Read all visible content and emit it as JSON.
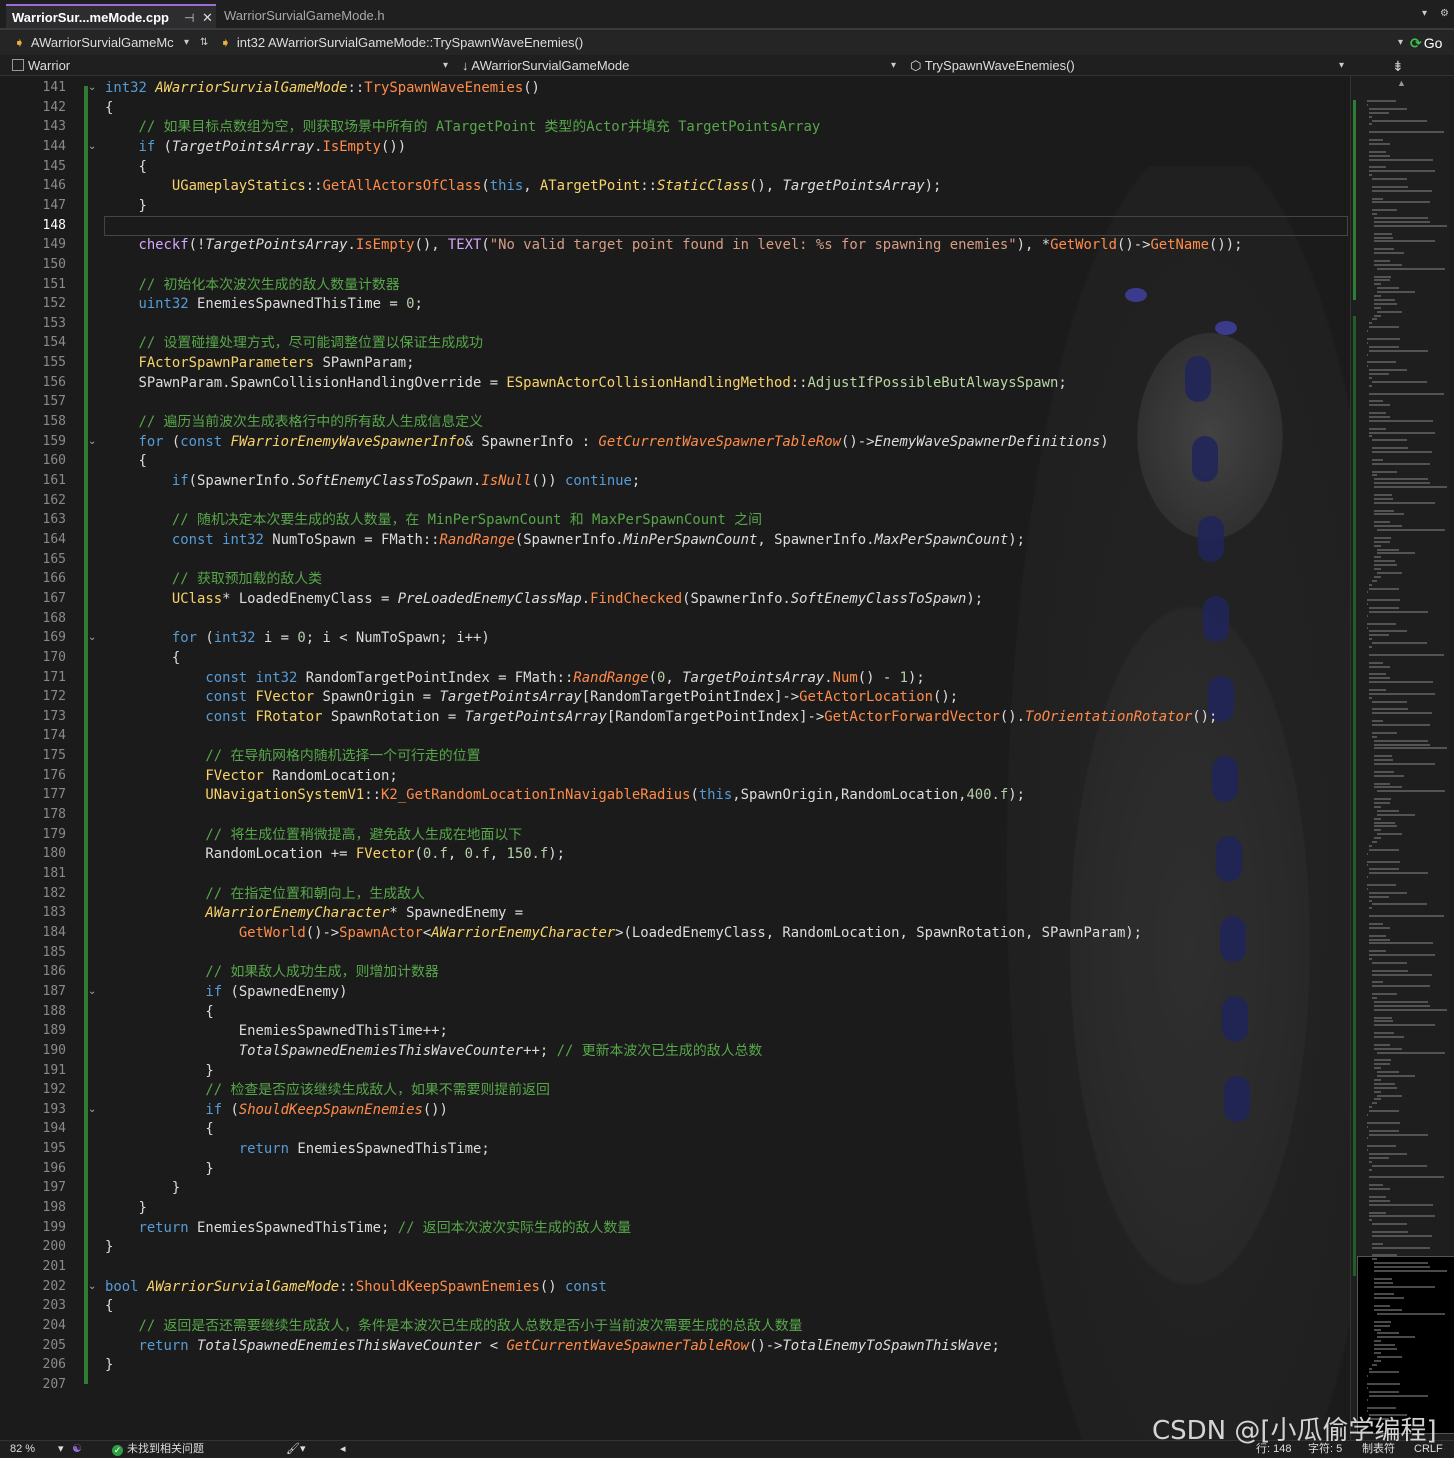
{
  "tabs": [
    {
      "label": "WarriorSur...meMode.cpp",
      "pin": "⊣",
      "close": "✕"
    },
    {
      "label": "WarriorSurvialGameMode.h"
    }
  ],
  "nav": {
    "class_combo": "AWarriorSurvialGameMc",
    "function_combo": "int32 AWarriorSurvialGameMode::TrySpawnWaveEnemies()",
    "go_label": "Go"
  },
  "scope": {
    "project": "Warrior",
    "class": "AWarriorSurvialGameMode",
    "member": "TrySpawnWaveEnemies()"
  },
  "editor": {
    "line_numbers": [
      "141",
      "142",
      "143",
      "144",
      "145",
      "146",
      "147",
      "148",
      "149",
      "150",
      "151",
      "152",
      "153",
      "154",
      "155",
      "156",
      "157",
      "158",
      "159",
      "160",
      "161",
      "162",
      "163",
      "164",
      "165",
      "166",
      "167",
      "168",
      "169",
      "170",
      "171",
      "172",
      "173",
      "174",
      "175",
      "176",
      "177",
      "178",
      "179",
      "180",
      "181",
      "182",
      "183",
      "184",
      "185",
      "186",
      "187",
      "188",
      "189",
      "190",
      "191",
      "192",
      "193",
      "194",
      "195",
      "196",
      "197",
      "198",
      "199",
      "200",
      "201",
      "202",
      "203",
      "204",
      "205",
      "206",
      "207"
    ],
    "current_line_index": 7
  },
  "code_lines": [
    [
      [
        "int32 ",
        "kw"
      ],
      [
        "AWarriorSurvialGameMode",
        "ut it"
      ],
      [
        "::",
        ""
      ],
      [
        "TrySpawnWaveEnemies",
        "fn"
      ],
      [
        "()",
        ""
      ]
    ],
    [
      [
        "{",
        ""
      ]
    ],
    [
      [
        "    ",
        ""
      ],
      [
        "// 如果目标点数组为空，则获取场景中所有的 ATargetPoint 类型的Actor并填充 TargetPointsArray",
        "cm"
      ]
    ],
    [
      [
        "    ",
        ""
      ],
      [
        "if ",
        "kw"
      ],
      [
        "(",
        ""
      ],
      [
        "TargetPointsArray",
        "it"
      ],
      [
        ".",
        ""
      ],
      [
        "IsEmpty",
        "fn"
      ],
      [
        "())",
        ""
      ]
    ],
    [
      [
        "    {",
        ""
      ]
    ],
    [
      [
        "        ",
        ""
      ],
      [
        "UGameplayStatics",
        "ut"
      ],
      [
        "::",
        ""
      ],
      [
        "GetAllActorsOfClass",
        "fn"
      ],
      [
        "(",
        ""
      ],
      [
        "this",
        "kw"
      ],
      [
        ", ",
        ""
      ],
      [
        "ATargetPoint",
        "ut"
      ],
      [
        "::",
        ""
      ],
      [
        "StaticClass",
        "ut it"
      ],
      [
        "(), ",
        ""
      ],
      [
        "TargetPointsArray",
        "it"
      ],
      [
        ");",
        ""
      ]
    ],
    [
      [
        "    }",
        ""
      ]
    ],
    [
      [
        "",
        ""
      ]
    ],
    [
      [
        "    ",
        ""
      ],
      [
        "checkf",
        "mac"
      ],
      [
        "(!",
        ""
      ],
      [
        "TargetPointsArray",
        "it"
      ],
      [
        ".",
        ""
      ],
      [
        "IsEmpty",
        "fn"
      ],
      [
        "(), ",
        ""
      ],
      [
        "TEXT",
        "mac"
      ],
      [
        "(",
        ""
      ],
      [
        "\"No valid target point found in level: %s for spawning enemies\"",
        "st"
      ],
      [
        "), *",
        ""
      ],
      [
        "GetWorld",
        "fn"
      ],
      [
        "()->",
        ""
      ],
      [
        "GetName",
        "fn"
      ],
      [
        "());",
        ""
      ]
    ],
    [
      [
        "",
        ""
      ]
    ],
    [
      [
        "    ",
        ""
      ],
      [
        "// 初始化本次波次生成的敌人数量计数器",
        "cm"
      ]
    ],
    [
      [
        "    ",
        ""
      ],
      [
        "uint32 ",
        "kw"
      ],
      [
        "EnemiesSpawnedThisTime = ",
        ""
      ],
      [
        "0",
        "nm"
      ],
      [
        ";",
        ""
      ]
    ],
    [
      [
        "",
        ""
      ]
    ],
    [
      [
        "    ",
        ""
      ],
      [
        "// 设置碰撞处理方式，尽可能调整位置以保证生成成功",
        "cm"
      ]
    ],
    [
      [
        "    ",
        ""
      ],
      [
        "FActorSpawnParameters ",
        "ut"
      ],
      [
        "SPawnParam;",
        ""
      ]
    ],
    [
      [
        "    SPawnParam.SpawnCollisionHandlingOverride = ",
        ""
      ],
      [
        "ESpawnActorCollisionHandlingMethod",
        "ut"
      ],
      [
        "::",
        ""
      ],
      [
        "AdjustIfPossibleButAlwaysSpawn",
        "en"
      ],
      [
        ";",
        ""
      ]
    ],
    [
      [
        "",
        ""
      ]
    ],
    [
      [
        "    ",
        ""
      ],
      [
        "// 遍历当前波次生成表格行中的所有敌人生成信息定义",
        "cm"
      ]
    ],
    [
      [
        "    ",
        ""
      ],
      [
        "for ",
        "kw"
      ],
      [
        "(",
        ""
      ],
      [
        "const ",
        "kw"
      ],
      [
        "FWarriorEnemyWaveSpawnerInfo",
        "ut it"
      ],
      [
        "& SpawnerInfo : ",
        ""
      ],
      [
        "GetCurrentWaveSpawnerTableRow",
        "fn it"
      ],
      [
        "()->",
        ""
      ],
      [
        "EnemyWaveSpawnerDefinitions",
        "it"
      ],
      [
        ")",
        ""
      ]
    ],
    [
      [
        "    {",
        ""
      ]
    ],
    [
      [
        "        ",
        ""
      ],
      [
        "if",
        "kw"
      ],
      [
        "(SpawnerInfo.",
        ""
      ],
      [
        "SoftEnemyClassToSpawn",
        "it"
      ],
      [
        ".",
        ""
      ],
      [
        "IsNull",
        "fn it"
      ],
      [
        "()) ",
        ""
      ],
      [
        "continue",
        "kw"
      ],
      [
        ";",
        ""
      ]
    ],
    [
      [
        "",
        ""
      ]
    ],
    [
      [
        "        ",
        ""
      ],
      [
        "// 随机决定本次要生成的敌人数量，在 MinPerSpawnCount 和 MaxPerSpawnCount 之间",
        "cm"
      ]
    ],
    [
      [
        "        ",
        ""
      ],
      [
        "const ",
        "kw"
      ],
      [
        "int32 ",
        "kw"
      ],
      [
        "NumToSpawn = FMath::",
        ""
      ],
      [
        "RandRange",
        "fn it"
      ],
      [
        "(SpawnerInfo.",
        ""
      ],
      [
        "MinPerSpawnCount",
        "it"
      ],
      [
        ", SpawnerInfo.",
        ""
      ],
      [
        "MaxPerSpawnCount",
        "it"
      ],
      [
        ");",
        ""
      ]
    ],
    [
      [
        "",
        ""
      ]
    ],
    [
      [
        "        ",
        ""
      ],
      [
        "// 获取预加载的敌人类",
        "cm"
      ]
    ],
    [
      [
        "        ",
        ""
      ],
      [
        "UClass",
        "ut"
      ],
      [
        "* LoadedEnemyClass = ",
        ""
      ],
      [
        "PreLoadedEnemyClassMap",
        "it"
      ],
      [
        ".",
        ""
      ],
      [
        "FindChecked",
        "fn"
      ],
      [
        "(SpawnerInfo.",
        ""
      ],
      [
        "SoftEnemyClassToSpawn",
        "it"
      ],
      [
        ");",
        ""
      ]
    ],
    [
      [
        "",
        ""
      ]
    ],
    [
      [
        "        ",
        ""
      ],
      [
        "for ",
        "kw"
      ],
      [
        "(",
        ""
      ],
      [
        "int32 ",
        "kw"
      ],
      [
        "i = ",
        ""
      ],
      [
        "0",
        "nm"
      ],
      [
        "; i < NumToSpawn; i++)",
        ""
      ]
    ],
    [
      [
        "        {",
        ""
      ]
    ],
    [
      [
        "            ",
        ""
      ],
      [
        "const ",
        "kw"
      ],
      [
        "int32 ",
        "kw"
      ],
      [
        "RandomTargetPointIndex = FMath::",
        ""
      ],
      [
        "RandRange",
        "fn it"
      ],
      [
        "(",
        ""
      ],
      [
        "0",
        "nm"
      ],
      [
        ", ",
        ""
      ],
      [
        "TargetPointsArray",
        "it"
      ],
      [
        ".",
        ""
      ],
      [
        "Num",
        "fn"
      ],
      [
        "() - ",
        ""
      ],
      [
        "1",
        "nm"
      ],
      [
        ");",
        ""
      ]
    ],
    [
      [
        "            ",
        ""
      ],
      [
        "const ",
        "kw"
      ],
      [
        "FVector ",
        "ut"
      ],
      [
        "SpawnOrigin = ",
        ""
      ],
      [
        "TargetPointsArray",
        "it"
      ],
      [
        "[RandomTargetPointIndex]->",
        ""
      ],
      [
        "GetActorLocation",
        "fn"
      ],
      [
        "();",
        ""
      ]
    ],
    [
      [
        "            ",
        ""
      ],
      [
        "const ",
        "kw"
      ],
      [
        "FRotator ",
        "ut"
      ],
      [
        "SpawnRotation = ",
        ""
      ],
      [
        "TargetPointsArray",
        "it"
      ],
      [
        "[RandomTargetPointIndex]->",
        ""
      ],
      [
        "GetActorForwardVector",
        "fn"
      ],
      [
        "().",
        ""
      ],
      [
        "ToOrientationRotator",
        "fn it"
      ],
      [
        "();",
        ""
      ]
    ],
    [
      [
        "",
        ""
      ]
    ],
    [
      [
        "            ",
        ""
      ],
      [
        "// 在导航网格内随机选择一个可行走的位置",
        "cm"
      ]
    ],
    [
      [
        "            ",
        ""
      ],
      [
        "FVector ",
        "ut"
      ],
      [
        "RandomLocation;",
        ""
      ]
    ],
    [
      [
        "            ",
        ""
      ],
      [
        "UNavigationSystemV1",
        "ut"
      ],
      [
        "::",
        ""
      ],
      [
        "K2_GetRandomLocationInNavigableRadius",
        "fn"
      ],
      [
        "(",
        ""
      ],
      [
        "this",
        "kw"
      ],
      [
        ",SpawnOrigin,RandomLocation,",
        ""
      ],
      [
        "400.f",
        "nm"
      ],
      [
        ");",
        ""
      ]
    ],
    [
      [
        "",
        ""
      ]
    ],
    [
      [
        "            ",
        ""
      ],
      [
        "// 将生成位置稍微提高，避免敌人生成在地面以下",
        "cm"
      ]
    ],
    [
      [
        "            RandomLocation += ",
        ""
      ],
      [
        "FVector",
        "ut"
      ],
      [
        "(",
        ""
      ],
      [
        "0.f",
        "nm"
      ],
      [
        ", ",
        ""
      ],
      [
        "0.f",
        "nm"
      ],
      [
        ", ",
        ""
      ],
      [
        "150.f",
        "nm"
      ],
      [
        ");",
        ""
      ]
    ],
    [
      [
        "",
        ""
      ]
    ],
    [
      [
        "            ",
        ""
      ],
      [
        "// 在指定位置和朝向上，生成敌人",
        "cm"
      ]
    ],
    [
      [
        "            ",
        ""
      ],
      [
        "AWarriorEnemyCharacter",
        "ut it"
      ],
      [
        "* SpawnedEnemy =",
        ""
      ]
    ],
    [
      [
        "                ",
        ""
      ],
      [
        "GetWorld",
        "fn"
      ],
      [
        "()->",
        ""
      ],
      [
        "SpawnActor",
        "fn"
      ],
      [
        "<",
        ""
      ],
      [
        "AWarriorEnemyCharacter",
        "ut it"
      ],
      [
        ">(LoadedEnemyClass, RandomLocation, SpawnRotation, SPawnParam);",
        ""
      ]
    ],
    [
      [
        "",
        ""
      ]
    ],
    [
      [
        "            ",
        ""
      ],
      [
        "// 如果敌人成功生成，则增加计数器",
        "cm"
      ]
    ],
    [
      [
        "            ",
        ""
      ],
      [
        "if ",
        "kw"
      ],
      [
        "(SpawnedEnemy)",
        ""
      ]
    ],
    [
      [
        "            {",
        ""
      ]
    ],
    [
      [
        "                EnemiesSpawnedThisTime++;",
        ""
      ]
    ],
    [
      [
        "                ",
        ""
      ],
      [
        "TotalSpawnedEnemiesThisWaveCounter",
        "it"
      ],
      [
        "++; ",
        ""
      ],
      [
        "// 更新本波次已生成的敌人总数",
        "cm"
      ]
    ],
    [
      [
        "            }",
        ""
      ]
    ],
    [
      [
        "            ",
        ""
      ],
      [
        "// 检查是否应该继续生成敌人，如果不需要则提前返回",
        "cm"
      ]
    ],
    [
      [
        "            ",
        ""
      ],
      [
        "if ",
        "kw"
      ],
      [
        "(",
        ""
      ],
      [
        "ShouldKeepSpawnEnemies",
        "fn it"
      ],
      [
        "())",
        ""
      ]
    ],
    [
      [
        "            {",
        ""
      ]
    ],
    [
      [
        "                ",
        ""
      ],
      [
        "return ",
        "kw"
      ],
      [
        "EnemiesSpawnedThisTime;",
        ""
      ]
    ],
    [
      [
        "            }",
        ""
      ]
    ],
    [
      [
        "        }",
        ""
      ]
    ],
    [
      [
        "    }",
        ""
      ]
    ],
    [
      [
        "    ",
        ""
      ],
      [
        "return ",
        "kw"
      ],
      [
        "EnemiesSpawnedThisTime; ",
        ""
      ],
      [
        "// 返回本次波次实际生成的敌人数量",
        "cm"
      ]
    ],
    [
      [
        "}",
        ""
      ]
    ],
    [
      [
        "",
        ""
      ]
    ],
    [
      [
        "",
        ""
      ],
      [
        "bool ",
        "kw"
      ],
      [
        "AWarriorSurvialGameMode",
        "ut it"
      ],
      [
        "::",
        ""
      ],
      [
        "ShouldKeepSpawnEnemies",
        "fn"
      ],
      [
        "() ",
        ""
      ],
      [
        "const",
        "kw"
      ]
    ],
    [
      [
        "{",
        ""
      ]
    ],
    [
      [
        "    ",
        ""
      ],
      [
        "// 返回是否还需要继续生成敌人，条件是本波次已生成的敌人总数是否小于当前波次需要生成的总敌人数量",
        "cm"
      ]
    ],
    [
      [
        "    ",
        ""
      ],
      [
        "return ",
        "kw"
      ],
      [
        "TotalSpawnedEnemiesThisWaveCounter",
        "it"
      ],
      [
        " < ",
        ""
      ],
      [
        "GetCurrentWaveSpawnerTableRow",
        "fn it"
      ],
      [
        "()->",
        ""
      ],
      [
        "TotalEnemyToSpawnThisWave",
        "it"
      ],
      [
        ";",
        ""
      ]
    ],
    [
      [
        "}",
        ""
      ]
    ],
    [
      [
        "",
        ""
      ]
    ]
  ],
  "fold_markers": {
    "lines": [
      0,
      3,
      18,
      28,
      46,
      52,
      61
    ],
    "glyph": "⌄"
  },
  "status": {
    "zoom": "82 %",
    "issues": "未找到相关问题",
    "line": "行: 148",
    "col": "字符: 5",
    "tabs": "制表符",
    "eol": "CRLF"
  },
  "watermark": "CSDN @[小瓜偷学编程]",
  "colors": {
    "accent": "#9a6dd7",
    "change_bar": "#2e7d32",
    "keyword": "#569cd6",
    "comment": "#57a64a"
  }
}
